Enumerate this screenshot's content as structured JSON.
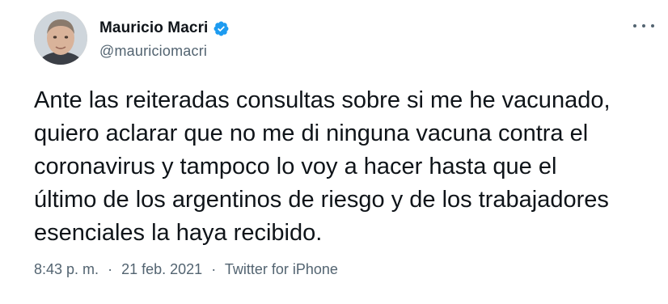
{
  "author": {
    "display_name": "Mauricio Macri",
    "handle": "@mauriciomacri",
    "verified": true,
    "verified_icon": "verified-badge-icon",
    "avatar_icon": "profile-photo"
  },
  "tweet": {
    "text": "Ante las reiteradas consultas sobre si me he vacunado,\nquiero aclarar que no me di ninguna vacuna contra el\ncoronavirus y tampoco lo voy a hacer hasta que el\núltimo de los argentinos de riesgo y de los trabajadores\nesenciales la haya recibido."
  },
  "meta": {
    "time": "8:43 p. m.",
    "separator": "·",
    "date": "21 feb. 2021",
    "source": "Twitter for iPhone"
  },
  "menu": {
    "icon": "more-options-icon"
  },
  "colors": {
    "verified": "#1d9bf0",
    "text": "#0f1419",
    "secondary": "#536471"
  }
}
